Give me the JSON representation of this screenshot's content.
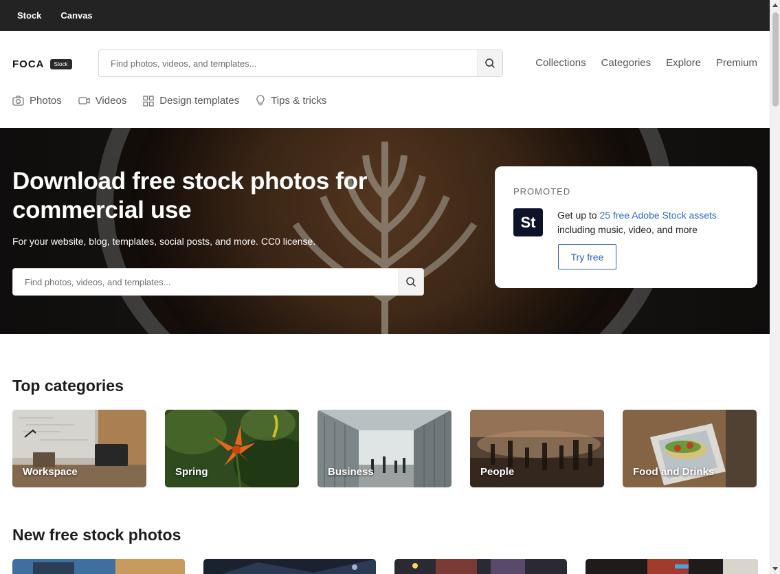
{
  "topbar": {
    "links": [
      "Stock",
      "Canvas"
    ]
  },
  "header": {
    "logo_text": "FOCA",
    "logo_badge": "Stock",
    "search_placeholder": "Find photos, videos, and templates...",
    "nav": [
      "Collections",
      "Categories",
      "Explore",
      "Premium"
    ],
    "subnav": [
      {
        "label": "Photos",
        "icon": "camera-icon"
      },
      {
        "label": "Videos",
        "icon": "video-icon"
      },
      {
        "label": "Design templates",
        "icon": "grid-icon"
      },
      {
        "label": "Tips & tricks",
        "icon": "lightbulb-icon"
      }
    ]
  },
  "hero": {
    "title": "Download free stock photos for commercial use",
    "subtitle": "For your website, blog, templates, social posts, and more. CC0 license.",
    "search_placeholder": "Find photos, videos, and templates..."
  },
  "promo": {
    "tag": "PROMOTED",
    "logo": "St",
    "text_before": "Get up to ",
    "link": "25 free Adobe Stock assets",
    "text_after": " including music, video, and more",
    "button": "Try free"
  },
  "categories": {
    "title": "Top categories",
    "items": [
      "Workspace",
      "Spring",
      "Business",
      "People",
      "Food and Drinks"
    ]
  },
  "new_photos": {
    "title": "New free stock photos"
  },
  "colors": {
    "topbar": "#232323",
    "accent": "#2f6bd1",
    "promo_logo_bg": "#0c1429"
  }
}
